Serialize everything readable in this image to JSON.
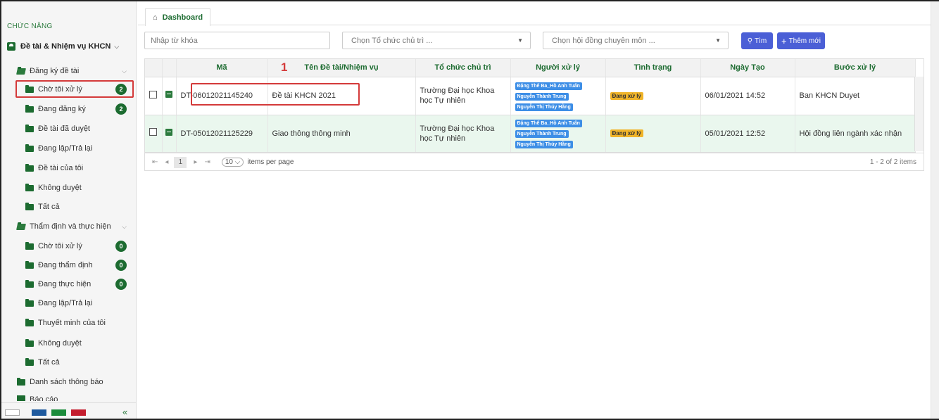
{
  "sidebar": {
    "section_title": "CHỨC NĂNG",
    "main_label": "Đề tài & Nhiệm vụ KHCN",
    "group1": "Đăng ký đề tài",
    "group1_items": [
      {
        "label": "Chờ tôi xử lý",
        "badge": "2"
      },
      {
        "label": "Đang đăng ký",
        "badge": "2"
      },
      {
        "label": "Đề tài đã duyệt"
      },
      {
        "label": "Đang lập/Trả lại"
      },
      {
        "label": "Đề tài của tôi"
      },
      {
        "label": "Không duyệt"
      },
      {
        "label": "Tất cả"
      }
    ],
    "group2": "Thẩm định và thực hiện",
    "group2_items": [
      {
        "label": "Chờ tôi xử lý",
        "badge": "0"
      },
      {
        "label": "Đang thẩm định",
        "badge": "0"
      },
      {
        "label": "Đang thực hiện",
        "badge": "0"
      },
      {
        "label": "Đang lập/Trả lại"
      },
      {
        "label": "Thuyết minh của tôi"
      },
      {
        "label": "Không duyệt"
      },
      {
        "label": "Tất cả"
      }
    ],
    "item_notices": "Danh sách thông báo",
    "item_reports": "Báo cáo",
    "collapse_icon": "«",
    "theme_colors": [
      "#ffffff",
      "#1f5a9e",
      "#1c8c3c",
      "#c41e2e"
    ]
  },
  "tabs": {
    "dashboard": "Dashboard"
  },
  "filters": {
    "keyword_placeholder": "Nhập từ khóa",
    "org_placeholder": "Chọn Tổ chức chủ trì ...",
    "council_placeholder": "Chọn hội đồng chuyên môn ...",
    "search_button": "Tìm",
    "add_button": "Thêm mới"
  },
  "table": {
    "headers": [
      "Mã",
      "Tên Đề tài/Nhiệm vụ",
      "Tổ chức chủ trì",
      "Người xử lý",
      "Tình trạng",
      "Ngày Tạo",
      "Bước xử lý"
    ],
    "rows": [
      {
        "code": "DT-06012021145240",
        "name": "Đề tài KHCN 2021",
        "org": "Trường Đại học Khoa học Tự nhiên",
        "handlers": [
          "Đặng Thế Ba_Hồ Anh Tuấn",
          "Nguyễn Thành Trung",
          "Nguyễn Thị Thúy Hằng"
        ],
        "status": "Đang xử lý",
        "created": "06/01/2021 14:52",
        "step": "Ban KHCN Duyet"
      },
      {
        "code": "DT-05012021125229",
        "name": "Giao thông thông minh",
        "org": "Trường Đại học Khoa học Tự nhiên",
        "handlers": [
          "Đặng Thế Ba_Hồ Anh Tuấn",
          "Nguyễn Thành Trung",
          "Nguyễn Thị Thúy Hằng"
        ],
        "status": "Đang xử lý",
        "created": "05/01/2021 12:52",
        "step": "Hội đồng liên ngành xác nhận"
      }
    ]
  },
  "pager": {
    "page": "1",
    "page_size": "10",
    "items_per_page": "items per page",
    "info": "1 - 2 of 2 items"
  },
  "annotation": {
    "marker": "1"
  },
  "colors": {
    "accent": "#1c6b30",
    "highlight": "#d43a3a",
    "button": "#4b5fd6",
    "tag": "#3d8ee6",
    "status": "#f0b429"
  }
}
